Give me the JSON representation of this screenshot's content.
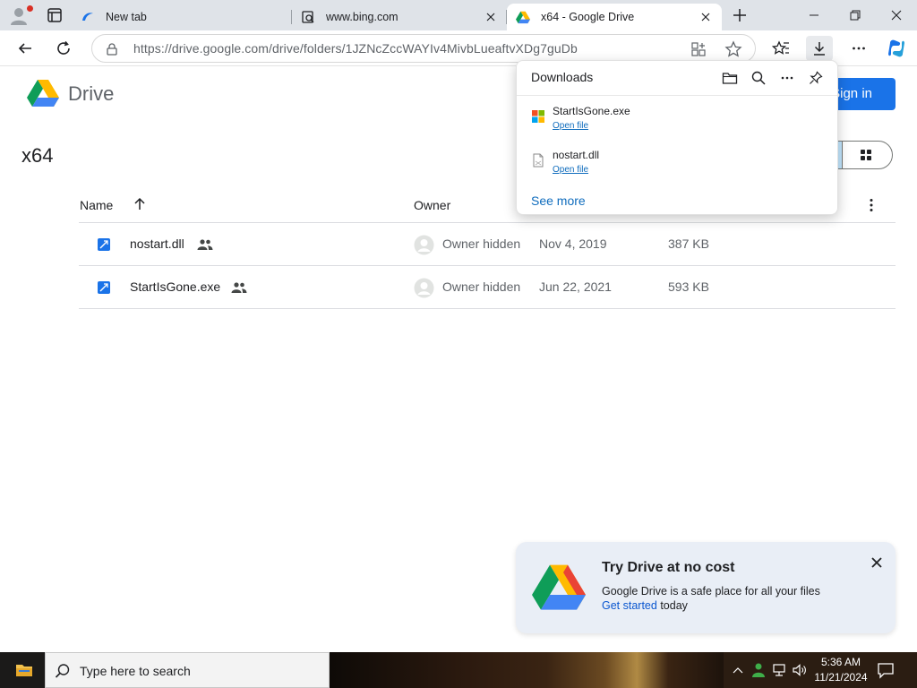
{
  "browser": {
    "tabs": [
      {
        "title": "New tab",
        "icon": "edge-newtab-icon",
        "active": false
      },
      {
        "title": "www.bing.com",
        "icon": "bing-page-icon",
        "active": false
      },
      {
        "title": "x64 - Google Drive",
        "icon": "google-drive-icon",
        "active": true
      }
    ],
    "url": "https://drive.google.com/drive/folders/1JZNcZccWAYIv4MivbLueaftvXDg7guDb"
  },
  "drive": {
    "brand": "Drive",
    "sign_in_label": "Sign in",
    "folder_title": "x64",
    "columns": {
      "name": "Name",
      "owner": "Owner"
    },
    "files": [
      {
        "name": "nostart.dll",
        "owner": "Owner hidden",
        "modified": "Nov 4, 2019",
        "size": "387 KB"
      },
      {
        "name": "StartIsGone.exe",
        "owner": "Owner hidden",
        "modified": "Jun 22, 2021",
        "size": "593 KB"
      }
    ]
  },
  "downloads": {
    "title": "Downloads",
    "items": [
      {
        "name": "StartIsGone.exe",
        "action": "Open file",
        "icon": "windows-exe-icon"
      },
      {
        "name": "nostart.dll",
        "action": "Open file",
        "icon": "file-icon"
      }
    ],
    "see_more": "See more"
  },
  "promo": {
    "title": "Try Drive at no cost",
    "line1": "Google Drive is a safe place for all your files",
    "link": "Get started",
    "line2_rest": " today"
  },
  "taskbar": {
    "search_placeholder": "Type here to search",
    "time": "5:36 AM",
    "date": "11/21/2024"
  },
  "colors": {
    "accent_blue": "#1a73e8",
    "link_blue": "#0f6cbd",
    "taskbar": "#2b1d12"
  }
}
